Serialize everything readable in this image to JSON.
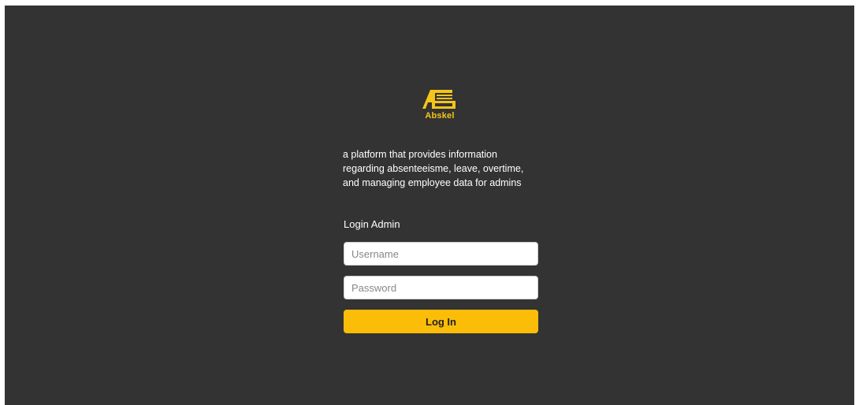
{
  "brand": {
    "name": "Abskel",
    "logo_icon": "abskel-logo-icon",
    "color": "#f5c518"
  },
  "tagline": {
    "line1": "a platform that provides information",
    "line2": "regarding absenteeisme, leave, overtime,",
    "line3": "and managing employee data for admins"
  },
  "login": {
    "heading": "Login Admin",
    "username_placeholder": "Username",
    "password_placeholder": "Password",
    "submit_label": "Log In",
    "button_color": "#fbbd08"
  },
  "theme": {
    "background": "#333333"
  }
}
